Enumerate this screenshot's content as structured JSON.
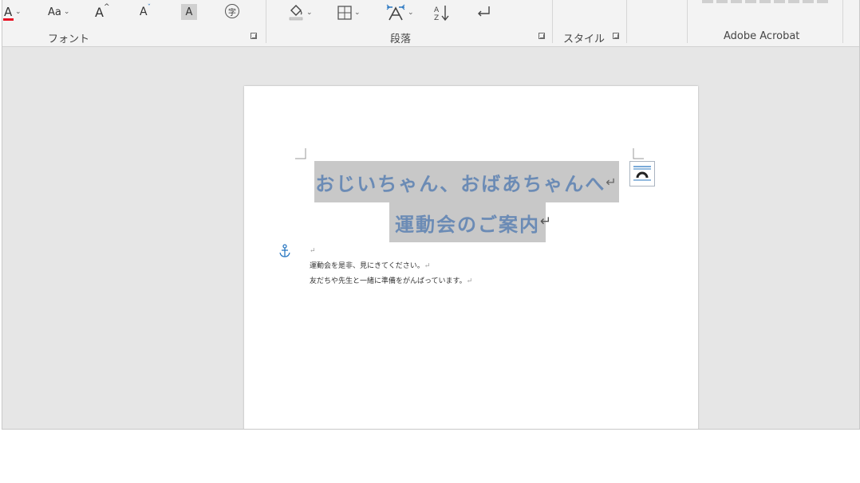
{
  "ribbon": {
    "font_group": {
      "label": "フォント",
      "buttons": {
        "font_color": "A",
        "change_case": "Aa",
        "grow_font": "A",
        "shrink_font": "A",
        "char_shading": "A",
        "enclose": "字"
      }
    },
    "paragraph_group": {
      "label": "段落"
    },
    "style_group": {
      "label": "スタイル"
    },
    "acrobat_group": {
      "label": "Adobe Acrobat"
    }
  },
  "document": {
    "wordart_line1": "おじいちゃん、おばあちゃんへ",
    "wordart_line2": "運動会のご案内",
    "return_mark": "↵",
    "body_lines": [
      "運動会を是非、見にきてください。",
      "友だちや先生と一緒に準備をがんばっています。"
    ]
  },
  "colors": {
    "wordart_text": "#6b8bb5",
    "selection": "#c8c8c8",
    "font_color_bar": "#e81123",
    "icon_blue": "#2b78c2"
  }
}
